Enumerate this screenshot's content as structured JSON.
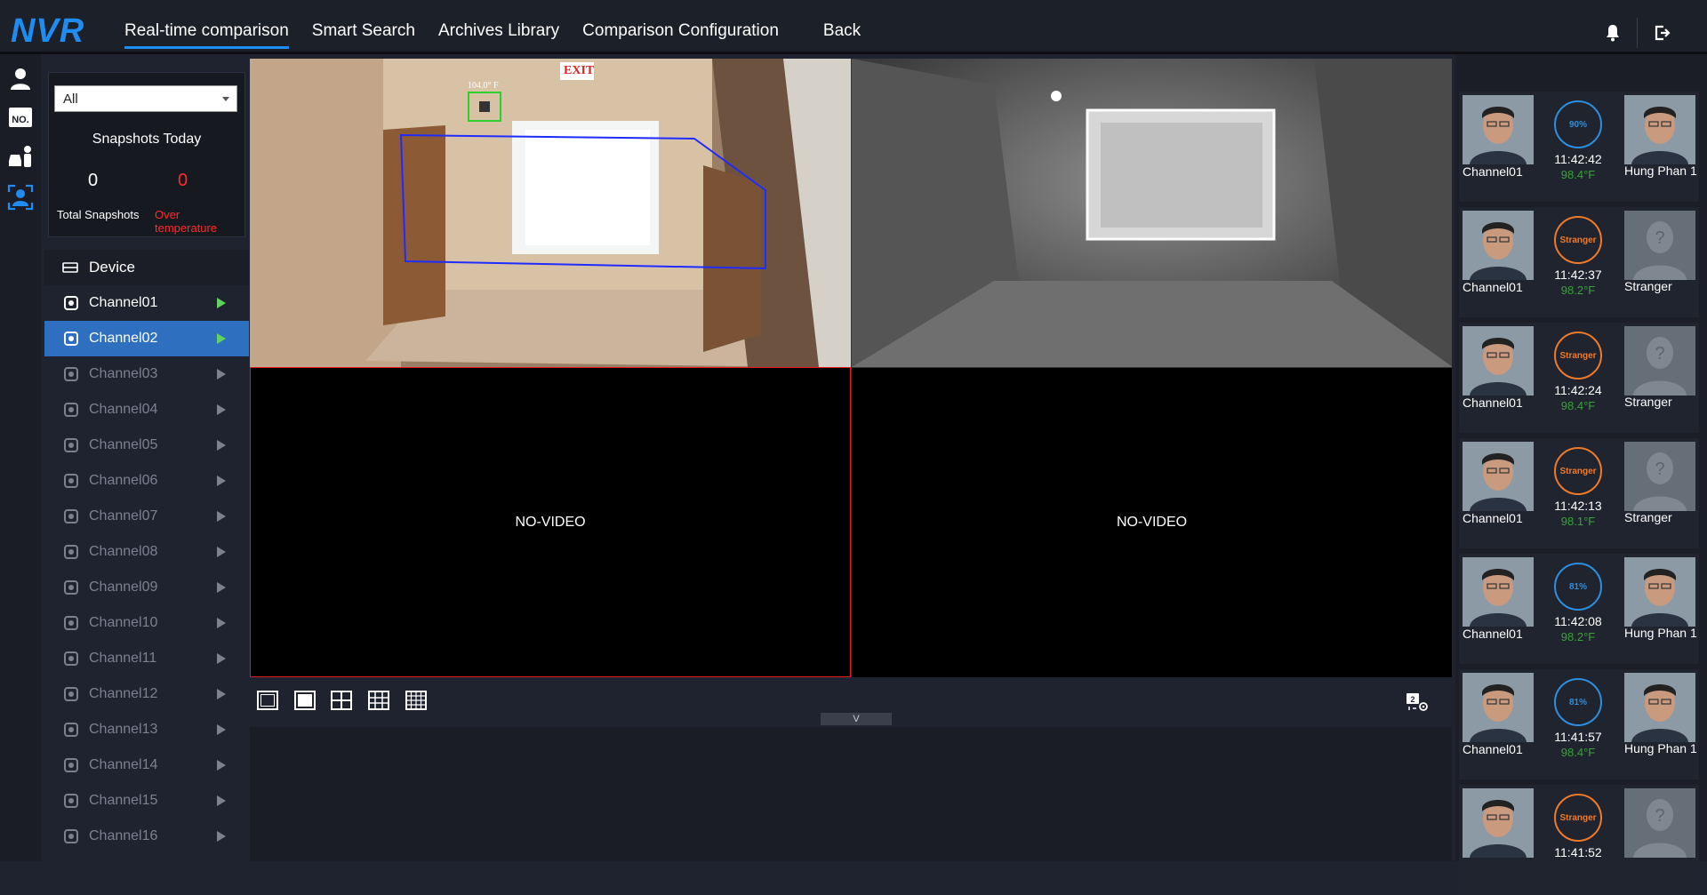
{
  "app": {
    "logo": "NVR"
  },
  "nav": {
    "tabs": [
      "Real-time comparison",
      "Smart Search",
      "Archives Library",
      "Comparison Configuration"
    ],
    "active_index": 0,
    "back": "Back"
  },
  "icons": {
    "bell": "bell-icon",
    "logout": "logout-icon",
    "sidebar": [
      "person-icon",
      "plate-number-icon",
      "vehicle-person-icon",
      "face-comparison-icon"
    ]
  },
  "snapshots": {
    "filter_value": "All",
    "title": "Snapshots Today",
    "total_count": "0",
    "over_count": "0",
    "total_label": "Total Snapshots",
    "over_label": "Over temperature"
  },
  "device": {
    "label": "Device"
  },
  "channels": [
    {
      "name": "Channel01",
      "state": "active"
    },
    {
      "name": "Channel02",
      "state": "selected"
    },
    {
      "name": "Channel03",
      "state": "inactive"
    },
    {
      "name": "Channel04",
      "state": "inactive"
    },
    {
      "name": "Channel05",
      "state": "inactive"
    },
    {
      "name": "Channel06",
      "state": "inactive"
    },
    {
      "name": "Channel07",
      "state": "inactive"
    },
    {
      "name": "Channel08",
      "state": "inactive"
    },
    {
      "name": "Channel09",
      "state": "inactive"
    },
    {
      "name": "Channel10",
      "state": "inactive"
    },
    {
      "name": "Channel11",
      "state": "inactive"
    },
    {
      "name": "Channel12",
      "state": "inactive"
    },
    {
      "name": "Channel13",
      "state": "inactive"
    },
    {
      "name": "Channel14",
      "state": "inactive"
    },
    {
      "name": "Channel15",
      "state": "inactive"
    },
    {
      "name": "Channel16",
      "state": "inactive"
    }
  ],
  "video": {
    "overlay_temp": "104.0° F",
    "exit_sign": "EXIT",
    "no_video": "NO-VIDEO"
  },
  "controls": {
    "collapse_left": "<",
    "collapse_down": "V"
  },
  "records": [
    {
      "channel": "Channel01",
      "result": "90%",
      "type": "match",
      "time": "11:42:42",
      "temp": "98.4°F",
      "name": "Hung Phan 1"
    },
    {
      "channel": "Channel01",
      "result": "Stranger",
      "type": "stranger",
      "time": "11:42:37",
      "temp": "98.2°F",
      "name": "Stranger"
    },
    {
      "channel": "Channel01",
      "result": "Stranger",
      "type": "stranger",
      "time": "11:42:24",
      "temp": "98.4°F",
      "name": "Stranger"
    },
    {
      "channel": "Channel01",
      "result": "Stranger",
      "type": "stranger",
      "time": "11:42:13",
      "temp": "98.1°F",
      "name": "Stranger"
    },
    {
      "channel": "Channel01",
      "result": "81%",
      "type": "match",
      "time": "11:42:08",
      "temp": "98.2°F",
      "name": "Hung Phan 1"
    },
    {
      "channel": "Channel01",
      "result": "81%",
      "type": "match",
      "time": "11:41:57",
      "temp": "98.4°F",
      "name": "Hung Phan 1"
    },
    {
      "channel": "",
      "result": "Stranger",
      "type": "stranger",
      "time": "11:41:52",
      "temp": "",
      "name": ""
    }
  ],
  "colors": {
    "accent": "#1e8cf0",
    "selected": "#2f6fc0",
    "over_temp": "#ff2a2a",
    "temp_ok": "#37a33a",
    "stranger": "#f07a2a"
  }
}
